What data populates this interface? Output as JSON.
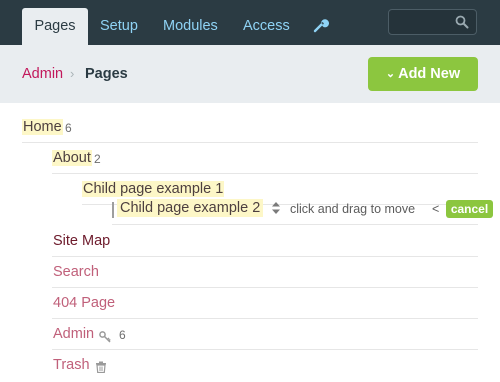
{
  "nav": {
    "tabs": [
      {
        "label": "Pages",
        "active": true
      },
      {
        "label": "Setup"
      },
      {
        "label": "Modules"
      },
      {
        "label": "Access"
      }
    ],
    "tools_icon": "wrench-icon",
    "search": {
      "value": "",
      "icon": "search-icon"
    }
  },
  "breadcrumb": {
    "parent": "Admin",
    "separator": "›",
    "current": "Pages"
  },
  "add_new": {
    "chevron": "⌄",
    "label": "Add New"
  },
  "tree": {
    "home": {
      "label": "Home",
      "count": "6"
    },
    "about": {
      "label": "About",
      "count": "2"
    },
    "child1": {
      "label": "Child page example 1"
    },
    "dragging": {
      "label": "Child page example 2",
      "move_icon": "sort-arrows-icon",
      "hint": "click and drag to move",
      "lt": "<",
      "cancel_label": "cancel"
    },
    "sitemap": {
      "label": "Site Map"
    },
    "search": {
      "label": "Search"
    },
    "page404": {
      "label": "404 Page"
    },
    "admin": {
      "label": "Admin",
      "icon": "key-icon",
      "count": "6"
    },
    "trash": {
      "label": "Trash",
      "icon": "trash-icon"
    }
  },
  "colors": {
    "topbar": "#2b3b43",
    "tab_text": "#8fd3f5",
    "accent_green": "#8cc63f",
    "link_pink": "#c0607a",
    "highlight": "#fdf7c7"
  }
}
